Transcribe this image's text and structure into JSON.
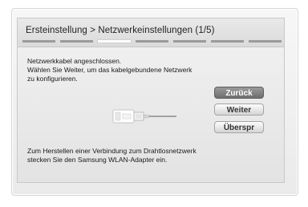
{
  "header": {
    "title": "Ersteinstellung > Netzwerkeinstellungen (1/5)",
    "step_current": 1,
    "step_total": 5
  },
  "dialog": {
    "message_lines": [
      "Netzwerkkabel angeschlossen.",
      "Wählen Sie Weiter, um das kabelgebundene Netzwerk",
      "zu konfigurieren."
    ],
    "wlan_lines": [
      "Zum Herstellen einer Verbindung zum Drahtlosnetzwerk",
      "stecken Sie den Samsung WLAN-Adapter ein."
    ],
    "illustration_icon": "ethernet-cable-icon"
  },
  "buttons": {
    "back_label": "Zurück",
    "next_label": "Weiter",
    "skip_label": "Überspr"
  },
  "colors": {
    "focused_button": "#7f7f7f",
    "step_active": "#ffffff",
    "step_inactive": "#9b9b9b"
  }
}
